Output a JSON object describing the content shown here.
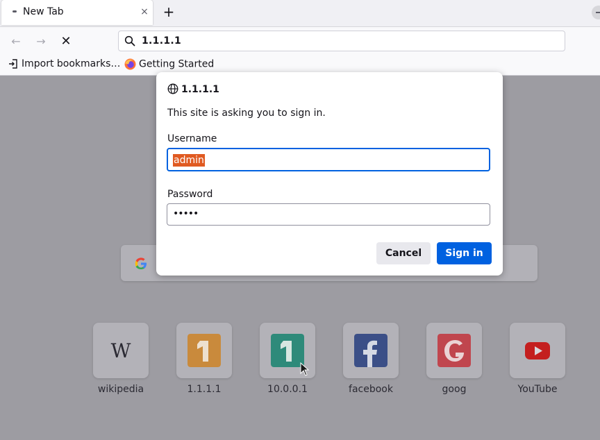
{
  "tab": {
    "title": "New Tab",
    "close_glyph": "×"
  },
  "newtab_glyph": "+",
  "nav": {
    "back_glyph": "←",
    "forward_glyph": "→",
    "stop_glyph": "✕"
  },
  "urlbar": {
    "value": "1.1.1.1"
  },
  "bookmarks": [
    {
      "label": "Import bookmarks…",
      "icon": "import-icon"
    },
    {
      "label": "Getting Started",
      "icon": "firefox-icon"
    }
  ],
  "dialog": {
    "host": "1.1.1.1",
    "message": "This site is asking you to sign in.",
    "username_label": "Username",
    "username_value": "admin",
    "password_label": "Password",
    "password_value": "•••••",
    "cancel_label": "Cancel",
    "signin_label": "Sign in"
  },
  "tiles": [
    {
      "label": "wikipedia",
      "icon": "wikipedia-icon"
    },
    {
      "label": "1.1.1.1",
      "icon": "number-one-orange-icon"
    },
    {
      "label": "10.0.0.1",
      "icon": "number-one-teal-icon"
    },
    {
      "label": "facebook",
      "icon": "facebook-icon"
    },
    {
      "label": "goog",
      "icon": "goog-icon"
    },
    {
      "label": "YouTube",
      "icon": "youtube-icon"
    }
  ],
  "colors": {
    "accent": "#0061e0",
    "selection": "#e05a21",
    "overlay": "#9d9ca2"
  }
}
